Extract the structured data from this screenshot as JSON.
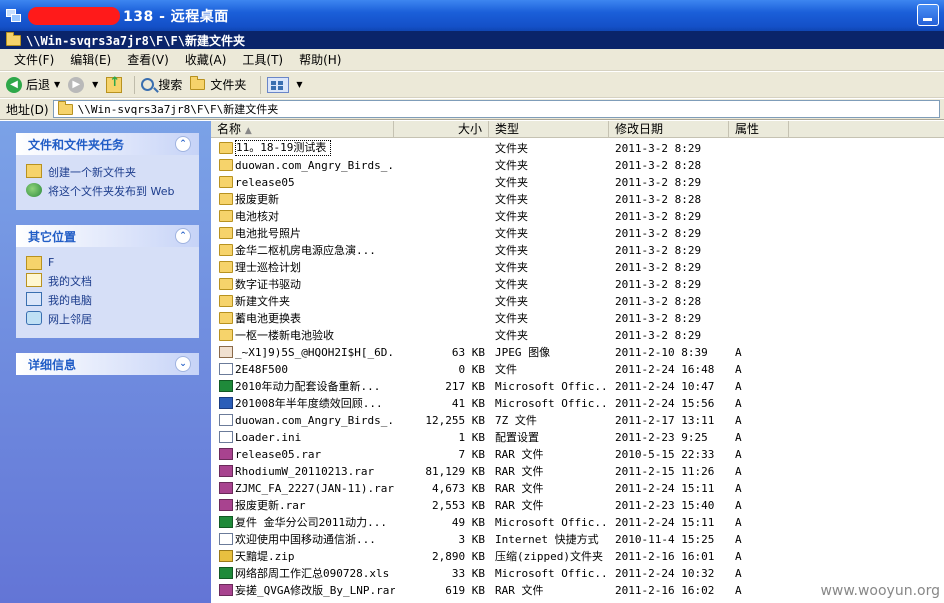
{
  "remote_desktop": {
    "title_suffix": "138 - 远程桌面"
  },
  "explorer": {
    "title": "\\\\Win-svqrs3a7jr8\\F\\F\\新建文件夹"
  },
  "menu": [
    "文件(F)",
    "编辑(E)",
    "查看(V)",
    "收藏(A)",
    "工具(T)",
    "帮助(H)"
  ],
  "toolbar": {
    "back": "后退",
    "search": "搜索",
    "folders": "文件夹"
  },
  "address": {
    "label": "地址(D)",
    "value": "\\\\Win-svqrs3a7jr8\\F\\F\\新建文件夹"
  },
  "tasks": {
    "file_tasks": {
      "title": "文件和文件夹任务",
      "items": [
        "创建一个新文件夹",
        "将这个文件夹发布到 Web"
      ]
    },
    "other_places": {
      "title": "其它位置",
      "items": [
        "F",
        "我的文档",
        "我的电脑",
        "网上邻居"
      ]
    },
    "details": {
      "title": "详细信息"
    }
  },
  "columns": {
    "name": "名称",
    "size": "大小",
    "type": "类型",
    "date": "修改日期",
    "attr": "属性"
  },
  "files": [
    {
      "name": "11。18-19测试表",
      "size": "",
      "type": "文件夹",
      "date": "2011-3-2 8:29",
      "attr": "",
      "icon": "folder"
    },
    {
      "name": "duowan.com_Angry_Birds_...",
      "size": "",
      "type": "文件夹",
      "date": "2011-3-2 8:28",
      "attr": "",
      "icon": "folder"
    },
    {
      "name": "release05",
      "size": "",
      "type": "文件夹",
      "date": "2011-3-2 8:29",
      "attr": "",
      "icon": "folder"
    },
    {
      "name": "报废更新",
      "size": "",
      "type": "文件夹",
      "date": "2011-3-2 8:28",
      "attr": "",
      "icon": "folder"
    },
    {
      "name": "电池核对",
      "size": "",
      "type": "文件夹",
      "date": "2011-3-2 8:29",
      "attr": "",
      "icon": "folder"
    },
    {
      "name": "电池批号照片",
      "size": "",
      "type": "文件夹",
      "date": "2011-3-2 8:29",
      "attr": "",
      "icon": "folder"
    },
    {
      "name": "金华二枢机房电源应急演...",
      "size": "",
      "type": "文件夹",
      "date": "2011-3-2 8:29",
      "attr": "",
      "icon": "folder"
    },
    {
      "name": "理士巡检计划",
      "size": "",
      "type": "文件夹",
      "date": "2011-3-2 8:29",
      "attr": "",
      "icon": "folder"
    },
    {
      "name": "数字证书驱动",
      "size": "",
      "type": "文件夹",
      "date": "2011-3-2 8:29",
      "attr": "",
      "icon": "folder"
    },
    {
      "name": "新建文件夹",
      "size": "",
      "type": "文件夹",
      "date": "2011-3-2 8:28",
      "attr": "",
      "icon": "folder"
    },
    {
      "name": "蓄电池更换表",
      "size": "",
      "type": "文件夹",
      "date": "2011-3-2 8:29",
      "attr": "",
      "icon": "folder"
    },
    {
      "name": "一枢一楼新电池验收",
      "size": "",
      "type": "文件夹",
      "date": "2011-3-2 8:29",
      "attr": "",
      "icon": "folder"
    },
    {
      "name": "_~X1]9)5S_@HQOH2I$H[_6D...",
      "size": "63 KB",
      "type": "JPEG 图像",
      "date": "2011-2-10 8:39",
      "attr": "A",
      "icon": "jpg"
    },
    {
      "name": "2E48F500",
      "size": "0 KB",
      "type": "文件",
      "date": "2011-2-24 16:48",
      "attr": "A",
      "icon": "file"
    },
    {
      "name": "2010年动力配套设备重新...",
      "size": "217 KB",
      "type": "Microsoft Offic...",
      "date": "2011-2-24 10:47",
      "attr": "A",
      "icon": "excel"
    },
    {
      "name": "201008年半年度绩效回顾...",
      "size": "41 KB",
      "type": "Microsoft Offic...",
      "date": "2011-2-24 15:56",
      "attr": "A",
      "icon": "word"
    },
    {
      "name": "duowan.com_Angry_Birds_...",
      "size": "12,255 KB",
      "type": "7Z 文件",
      "date": "2011-2-17 13:11",
      "attr": "A",
      "icon": "file"
    },
    {
      "name": "Loader.ini",
      "size": "1 KB",
      "type": "配置设置",
      "date": "2011-2-23 9:25",
      "attr": "A",
      "icon": "file"
    },
    {
      "name": "release05.rar",
      "size": "7 KB",
      "type": "RAR 文件",
      "date": "2010-5-15 22:33",
      "attr": "A",
      "icon": "rar"
    },
    {
      "name": "RhodiumW_20110213.rar",
      "size": "81,129 KB",
      "type": "RAR 文件",
      "date": "2011-2-15 11:26",
      "attr": "A",
      "icon": "rar"
    },
    {
      "name": "ZJMC_FA_2227(JAN-11).rar",
      "size": "4,673 KB",
      "type": "RAR 文件",
      "date": "2011-2-24 15:11",
      "attr": "A",
      "icon": "rar"
    },
    {
      "name": "报废更新.rar",
      "size": "2,553 KB",
      "type": "RAR 文件",
      "date": "2011-2-23 15:40",
      "attr": "A",
      "icon": "rar"
    },
    {
      "name": "复件 金华分公司2011动力...",
      "size": "49 KB",
      "type": "Microsoft Offic...",
      "date": "2011-2-24 15:11",
      "attr": "A",
      "icon": "excel"
    },
    {
      "name": "欢迎使用中国移动通信浙...",
      "size": "3 KB",
      "type": "Internet 快捷方式",
      "date": "2010-11-4 15:25",
      "attr": "A",
      "icon": "file"
    },
    {
      "name": "天黯堤.zip",
      "size": "2,890 KB",
      "type": "压缩(zipped)文件夹",
      "date": "2011-2-16 16:01",
      "attr": "A",
      "icon": "zip"
    },
    {
      "name": "网络部周工作汇总090728.xls",
      "size": "33 KB",
      "type": "Microsoft Offic...",
      "date": "2011-2-24 10:32",
      "attr": "A",
      "icon": "excel"
    },
    {
      "name": "妄搓_QVGA修改版_By_LNP.rar",
      "size": "619 KB",
      "type": "RAR 文件",
      "date": "2011-2-16 16:02",
      "attr": "A",
      "icon": "rar"
    }
  ],
  "watermark": "www.wooyun.org"
}
